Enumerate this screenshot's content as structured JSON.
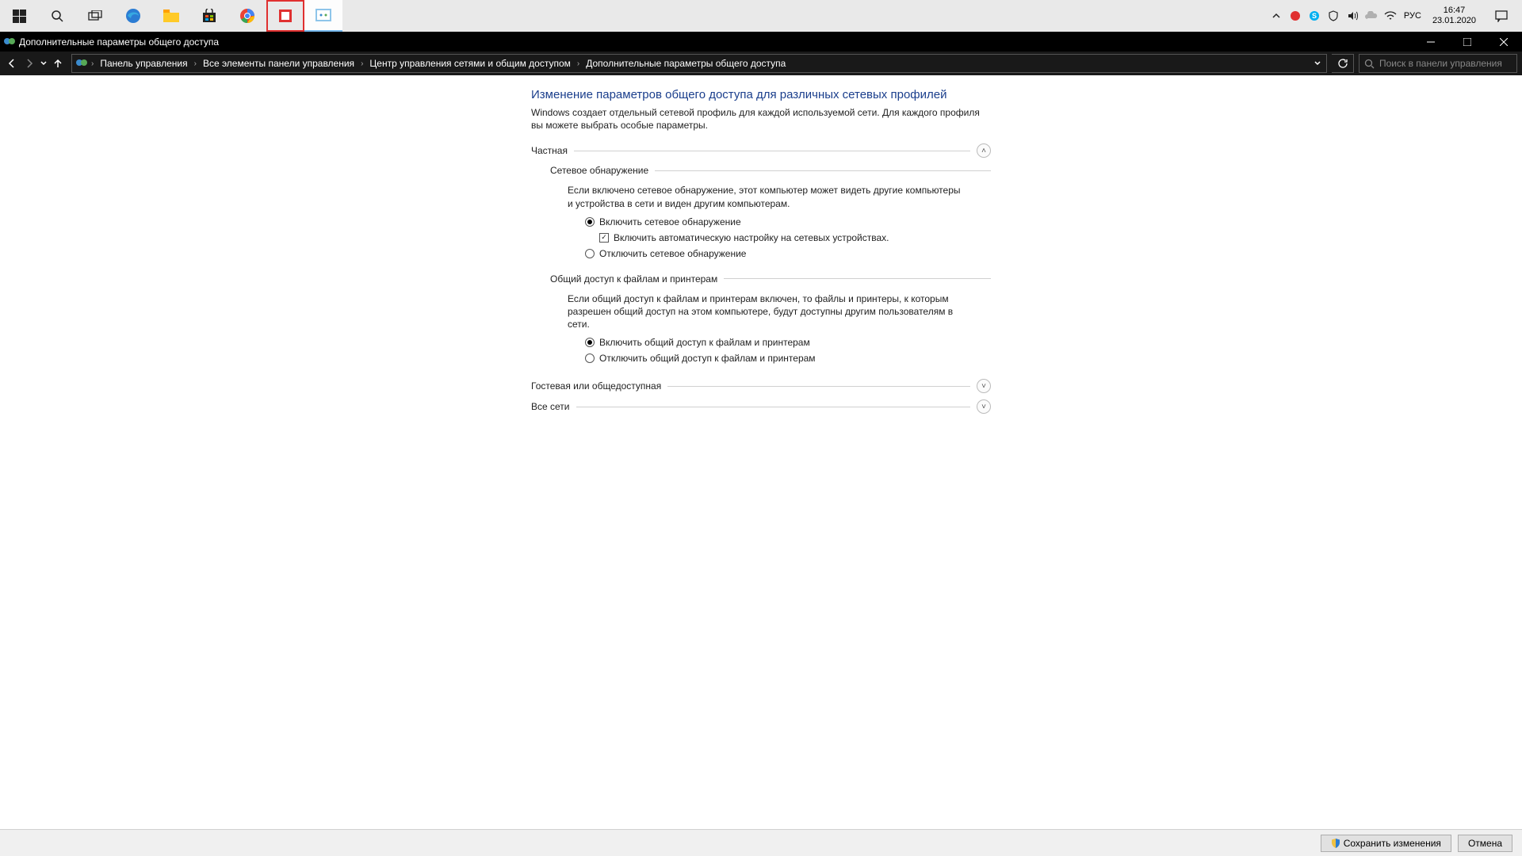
{
  "taskbar": {
    "time": "16:47",
    "date": "23.01.2020",
    "lang": "РУС"
  },
  "window": {
    "title": "Дополнительные параметры общего доступа"
  },
  "breadcrumb": {
    "items": [
      "Панель управления",
      "Все элементы панели управления",
      "Центр управления сетями и общим доступом",
      "Дополнительные параметры общего доступа"
    ]
  },
  "search": {
    "placeholder": "Поиск в панели управления"
  },
  "page": {
    "title": "Изменение параметров общего доступа для различных сетевых профилей",
    "desc": "Windows создает отдельный сетевой профиль для каждой используемой сети. Для каждого профиля вы можете выбрать особые параметры."
  },
  "sections": {
    "private": {
      "label": "Частная",
      "network_discovery": {
        "legend": "Сетевое обнаружение",
        "desc": "Если включено сетевое обнаружение, этот компьютер может видеть другие компьютеры и устройства в сети и виден другим компьютерам.",
        "radio_on": "Включить сетевое обнаружение",
        "checkbox_auto": "Включить автоматическую настройку на сетевых устройствах.",
        "radio_off": "Отключить сетевое обнаружение"
      },
      "file_printer": {
        "legend": "Общий доступ к файлам и принтерам",
        "desc": "Если общий доступ к файлам и принтерам включен, то файлы и принтеры, к которым разрешен общий доступ на этом компьютере, будут доступны другим пользователям в сети.",
        "radio_on": "Включить общий доступ к файлам и принтерам",
        "radio_off": "Отключить общий доступ к файлам и принтерам"
      }
    },
    "guest": {
      "label": "Гостевая или общедоступная"
    },
    "all": {
      "label": "Все сети"
    }
  },
  "footer": {
    "save": "Сохранить изменения",
    "cancel": "Отмена"
  }
}
